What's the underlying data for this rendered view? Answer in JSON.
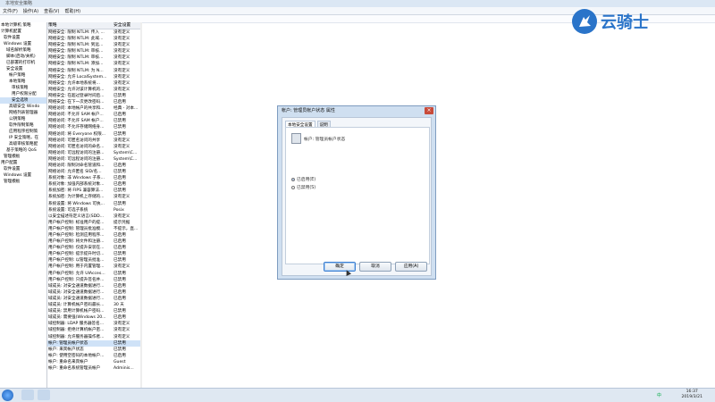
{
  "window": {
    "title": "本地安全策略"
  },
  "menu": [
    "文件(F)",
    "操作(A)",
    "查看(V)",
    "帮助(H)"
  ],
  "tree": [
    "本地计算机 策略",
    "计算机配置",
    "软件设置",
    "Windows 设置",
    "域名解析策略",
    "脚本(启动/关机)",
    "已部署的打印机",
    "安全设置",
    "帐户策略",
    "本地策略",
    "审核策略",
    "用户权限分配",
    "安全选项",
    "高级安全 Windo",
    "网络列表管理器",
    "公钥策略",
    "软件限制策略",
    "应用程序控制策",
    "IP 安全策略，在",
    "高级审核策略配",
    "基于策略的 QoS",
    "管理模板",
    "用户配置",
    "软件设置",
    "Windows 设置",
    "管理模板"
  ],
  "columns": {
    "policy": "策略",
    "setting": "安全设置"
  },
  "policy_rows": [
    [
      "网络安全: 限制 NTLM: 传入 ...",
      "没有定义"
    ],
    [
      "网络安全: 限制 NTLM: 此域...",
      "没有定义"
    ],
    [
      "网络安全: 限制 NTLM: 到远...",
      "没有定义"
    ],
    [
      "网络安全: 限制 NTLM: 审核...",
      "没有定义"
    ],
    [
      "网络安全: 限制 NTLM: 审核...",
      "没有定义"
    ],
    [
      "网络安全: 限制 NTLM: 添加...",
      "没有定义"
    ],
    [
      "网络安全: 限制 NTLM: 为 N...",
      "没有定义"
    ],
    [
      "网络安全: 允许 LocalSystem...",
      "没有定义"
    ],
    [
      "网络安全: 允许本地系统将...",
      "没有定义"
    ],
    [
      "网络安全: 允许对该计算机的...",
      "没有定义"
    ],
    [
      "网络安全: 在超过登录时间后...",
      "已禁用"
    ],
    [
      "网络安全: 在下一次更改密码...",
      "已启用"
    ],
    [
      "网络访问: 本地帐户的共享和...",
      "经典 - 对本..."
    ],
    [
      "网络访问: 不允许 SAM 帐户...",
      "已启用"
    ],
    [
      "网络访问: 不允许 SAM 帐户...",
      "已禁用"
    ],
    [
      "网络访问: 不允许存储网络身...",
      "已禁用"
    ],
    [
      "网络访问: 将 Everyone 权限...",
      "已禁用"
    ],
    [
      "网络访问: 可匿名访问的共享",
      "没有定义"
    ],
    [
      "网络访问: 可匿名访问的命名...",
      "没有定义"
    ],
    [
      "网络访问: 可远程访问的注册...",
      "System\\C..."
    ],
    [
      "网络访问: 可远程访问的注册...",
      "System\\C..."
    ],
    [
      "网络访问: 限制对命名管道和...",
      "已启用"
    ],
    [
      "网络访问: 允许匿名 SID/名...",
      "已禁用"
    ],
    [
      "系统对象: 非 Windows 子系...",
      "已启用"
    ],
    [
      "系统对象: 加强内部系统对象...",
      "已启用"
    ],
    [
      "系统加密: 将 FIPS 兼容算法...",
      "已禁用"
    ],
    [
      "系统加密: 为计算机上存储的...",
      "没有定义"
    ],
    [
      "系统设置: 将 Windows 可执...",
      "已禁用"
    ],
    [
      "系统设置: 可选子系统",
      "Posix"
    ],
    [
      "以安全描述符定义语言(SDD...",
      "没有定义"
    ],
    [
      "用户帐户控制: 标准用户的提...",
      "提示凭据"
    ],
    [
      "用户帐户控制: 管理员批准模...",
      "不提示，直..."
    ],
    [
      "用户帐户控制: 检测应用程序...",
      "已启用"
    ],
    [
      "用户帐户控制: 将文件和注册...",
      "已启用"
    ],
    [
      "用户帐户控制: 仅提升安装在...",
      "已启用"
    ],
    [
      "用户帐户控制: 提示提升时切...",
      "已禁用"
    ],
    [
      "用户帐户控制: 以管理员批准...",
      "已禁用"
    ],
    [
      "用户帐户控制: 用于内置管理...",
      "没有定义"
    ],
    [
      "用户帐户控制: 允许 UIAcces...",
      "已禁用"
    ],
    [
      "用户帐户控制: 只提升签名并...",
      "已禁用"
    ],
    [
      "域成员: 对安全通道数据进行...",
      "已启用"
    ],
    [
      "域成员: 对安全通道数据进行...",
      "已启用"
    ],
    [
      "域成员: 对安全通道数据进行...",
      "已启用"
    ],
    [
      "域成员: 计算机帐户密码最长...",
      "30 天"
    ],
    [
      "域成员: 禁用计算机帐户密码...",
      "已禁用"
    ],
    [
      "域成员: 需要强(Windows 20...",
      "已启用"
    ],
    [
      "域控制器: LDAP 服务器签名...",
      "没有定义"
    ],
    [
      "域控制器: 拒绝计算机帐户密...",
      "没有定义"
    ],
    [
      "域控制器: 允许服务器操作者...",
      "没有定义"
    ],
    [
      "帐户: 管理员帐户状态",
      "已禁用"
    ],
    [
      "帐户: 来宾帐户状态",
      "已禁用"
    ],
    [
      "帐户: 使用空密码的本地帐户...",
      "已启用"
    ],
    [
      "帐户: 重命名来宾帐户",
      "Guest"
    ],
    [
      "帐户: 重命名系统管理员帐户",
      "Adminis..."
    ]
  ],
  "dialog": {
    "title": "帐户: 管理员帐户状态 属性",
    "tab_local": "本地安全设置",
    "tab_explain": "说明",
    "policy_name": "帐户: 管理员帐户状态",
    "option_enabled": "已启用(E)",
    "option_disabled": "已禁用(S)",
    "selected": "enabled",
    "ok": "确定",
    "cancel": "取消",
    "apply": "应用(A)"
  },
  "logo": {
    "text": "云骑士"
  },
  "taskbar": {
    "time": "16:37",
    "date": "2019/3/21",
    "ime": "中"
  }
}
